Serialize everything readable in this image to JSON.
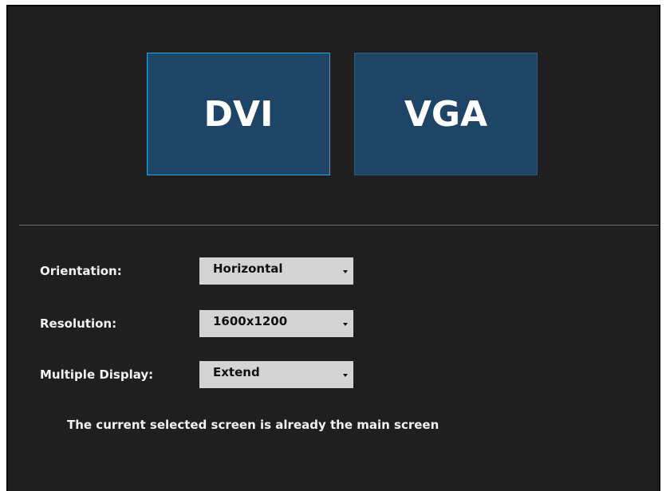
{
  "displays": [
    {
      "label": "DVI",
      "selected": true
    },
    {
      "label": "VGA",
      "selected": false
    }
  ],
  "settings": {
    "orientation": {
      "label": "Orientation:",
      "value": "Horizontal"
    },
    "resolution": {
      "label": "Resolution:",
      "value": "1600x1200"
    },
    "multiple_display": {
      "label": "Multiple Display:",
      "value": "Extend"
    }
  },
  "info_message": "The current selected screen is already the main screen",
  "colors": {
    "background": "#1f1f1f",
    "monitor_fill": "#1e4566",
    "selected_border": "#23a6e0",
    "dropdown_fill": "#d4d4d4"
  },
  "icons": {
    "dropdown": "chevron-down-icon"
  }
}
